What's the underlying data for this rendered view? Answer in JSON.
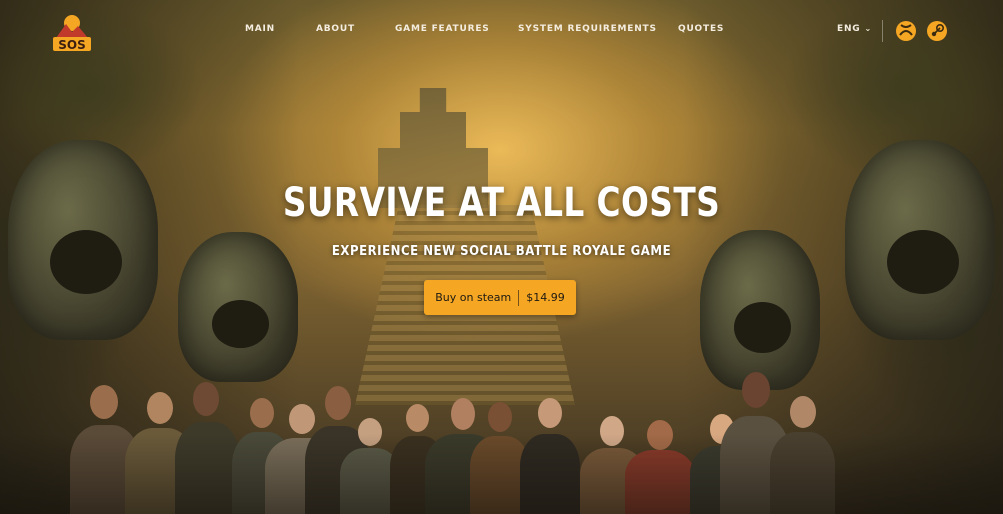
{
  "nav": {
    "items": [
      {
        "label": "MAIN"
      },
      {
        "label": "ABOUT"
      },
      {
        "label": "GAME FEATURES"
      },
      {
        "label": "SYSTEM REQUIREMENTS"
      },
      {
        "label": "QUOTES"
      }
    ]
  },
  "header": {
    "logo_text": "SOS",
    "language": "ENG",
    "platforms": [
      "xbox-icon",
      "steam-icon"
    ]
  },
  "hero": {
    "headline": "SURVIVE AT ALL COSTS",
    "subheadline": "EXPERIENCE NEW SOCIAL BATTLE ROYALE GAME",
    "cta_label": "Buy on steam",
    "cta_price": "$14.99"
  },
  "colors": {
    "accent": "#f5a623",
    "text": "#ffffff"
  }
}
